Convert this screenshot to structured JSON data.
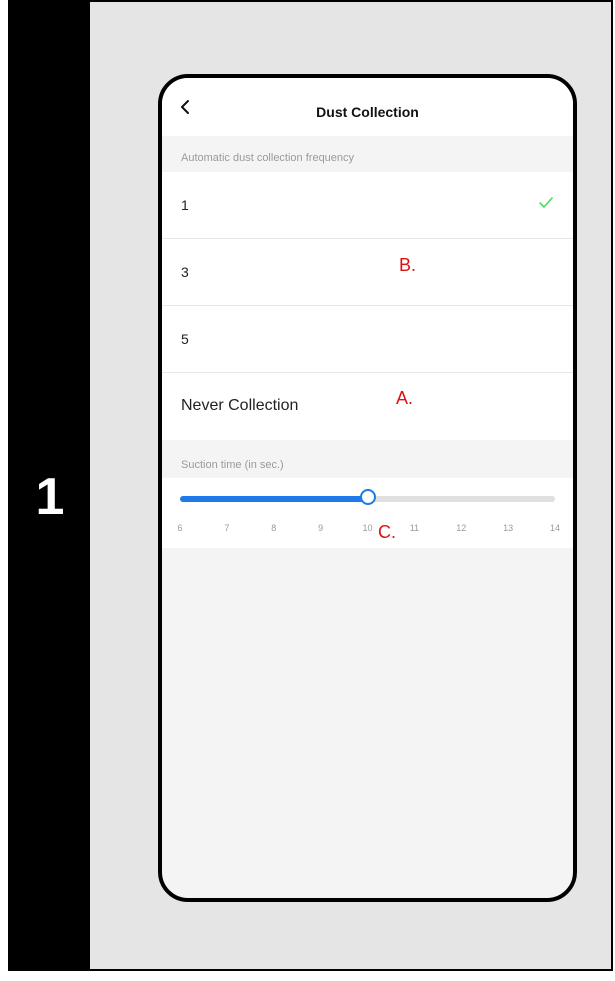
{
  "step_number": "1",
  "header": {
    "title": "Dust Collection"
  },
  "frequency": {
    "section_label": "Automatic dust collection frequency",
    "items": [
      {
        "label": "1",
        "selected": true
      },
      {
        "label": "3",
        "selected": false
      },
      {
        "label": "5",
        "selected": false
      },
      {
        "label": "Never Collection",
        "selected": false
      }
    ]
  },
  "suction": {
    "section_label": "Suction time (in sec.)",
    "ticks": [
      "6",
      "7",
      "8",
      "9",
      "10",
      "11",
      "12",
      "13",
      "14"
    ],
    "min": 6,
    "max": 14,
    "value": 10
  },
  "annotations": {
    "a": "A.",
    "b": "B.",
    "c": "C."
  },
  "colors": {
    "accent": "#1e7ae8",
    "check": "#4cd964",
    "annotation": "#e01010"
  },
  "icons": {
    "back": "chevron-left-icon",
    "check": "checkmark-icon"
  }
}
